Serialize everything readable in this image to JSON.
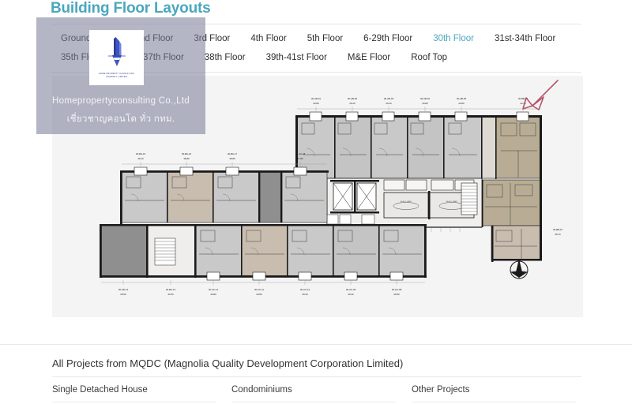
{
  "header": {
    "title": "Building Floor Layouts"
  },
  "tabs": {
    "items": [
      {
        "label": "Ground Floor",
        "active": false
      },
      {
        "label": "2nd Floor",
        "active": false
      },
      {
        "label": "3rd Floor",
        "active": false
      },
      {
        "label": "4th Floor",
        "active": false
      },
      {
        "label": "5th Floor",
        "active": false
      },
      {
        "label": "6-29th Floor",
        "active": false
      },
      {
        "label": "30th Floor",
        "active": true
      },
      {
        "label": "31st-34th Floor",
        "active": false
      },
      {
        "label": "35th Floor",
        "active": false
      },
      {
        "label": "36th-37th Floor",
        "active": false
      },
      {
        "label": "38th Floor",
        "active": false
      },
      {
        "label": "39th-41st Floor",
        "active": false
      },
      {
        "label": "M&E Floor",
        "active": false
      },
      {
        "label": "Roof Top",
        "active": false
      }
    ]
  },
  "watermark": {
    "company": "Homepropertyconsulting Co.,Ltd",
    "tagline": "เชี่ยวชาญคอนโด ทั่ว กทม.",
    "logo_caption_line1": "HOME PROPERTY CONSULTING",
    "logo_caption_line2": "COMPANY LIMITED"
  },
  "floorplan": {
    "compass_label": "N",
    "annotation": "red-arrow-pointing-to-corner-unit",
    "top_units": [
      {
        "code": "30-AB-01",
        "area": "29.80"
      },
      {
        "code": "30-AB-02",
        "area": "29.20"
      },
      {
        "code": "30-AB-03",
        "area": "29.20"
      },
      {
        "code": "30-AB-04",
        "area": "29.80"
      },
      {
        "code": "30-AB-05",
        "area": "29.80"
      },
      {
        "code": "30-BB-06",
        "area": "42.20"
      }
    ],
    "left_units": [
      {
        "code": "30-BA-15",
        "area": "38.10"
      },
      {
        "code": "30-BA-16",
        "area": "38.80"
      },
      {
        "code": "30-BA-17",
        "area": "38.80"
      },
      {
        "code": "30-AA-18",
        "area": "27.80"
      }
    ],
    "bottom_units": [
      {
        "code": "30-AD-14",
        "area": "28.50"
      },
      {
        "code": "30-BA-13",
        "area": "40.50"
      },
      {
        "code": "30-AC-12",
        "area": "29.80"
      },
      {
        "code": "30-AC-11",
        "area": "29.80"
      },
      {
        "code": "30-AC-10",
        "area": "29.30"
      },
      {
        "code": "30-AC-09",
        "area": "29.30"
      },
      {
        "code": "30-AC-08",
        "area": "29.80"
      }
    ],
    "right_units": [
      {
        "code": "30-BB-07",
        "area": "38.70"
      }
    ],
    "core_rooms": [
      {
        "label": "ELEV. LOBBY"
      },
      {
        "label": "ELEV. LOBBY"
      },
      {
        "label": "STAIR"
      },
      {
        "label": "SHAFT"
      }
    ]
  },
  "bottom": {
    "title": "All Projects from MQDC (Magnolia Quality Development Corporation Limited)",
    "columns": [
      {
        "label": "Single Detached House"
      },
      {
        "label": "Condominiums"
      },
      {
        "label": "Other Projects"
      }
    ]
  },
  "colors": {
    "accent": "#4aa7bd",
    "panel_bg": "#f4f4f4",
    "unit_gray": "#c9c9c9",
    "unit_dark": "#8f8f8f",
    "unit_taupe": "#b8ad94",
    "unit_beige": "#c9bdb0",
    "wall": "#1a1a1a",
    "annotation_red": "#b4566a"
  }
}
